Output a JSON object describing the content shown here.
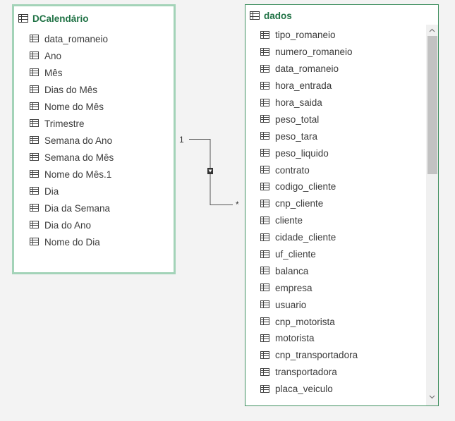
{
  "left_table": {
    "title": "DCalendário",
    "fields": [
      "data_romaneio",
      "Ano",
      "Mês",
      "Dias do Mês",
      "Nome do Mês",
      "Trimestre",
      "Semana do Ano",
      "Semana do Mês",
      "Nome do Mês.1",
      "Dia",
      "Dia da Semana",
      "Dia do Ano",
      "Nome do Dia"
    ]
  },
  "right_table": {
    "title": "dados",
    "fields": [
      "tipo_romaneio",
      "numero_romaneio",
      "data_romaneio",
      "hora_entrada",
      "hora_saida",
      "peso_total",
      "peso_tara",
      "peso_liquido",
      "contrato",
      "codigo_cliente",
      "cnp_cliente",
      "cliente",
      "cidade_cliente",
      "uf_cliente",
      "balanca",
      "empresa",
      "usuario",
      "cnp_motorista",
      "motorista",
      "cnp_transportadora",
      "transportadora",
      "placa_veiculo"
    ]
  },
  "relationship": {
    "one_label": "1",
    "many_label": "*"
  },
  "colors": {
    "accent": "#217346",
    "active_border": "#a3d3b8",
    "border": "#3f8f5f"
  },
  "icons": {
    "table": "table-icon",
    "field": "field-table-icon",
    "up": "chevron-up-icon",
    "down": "chevron-down-icon"
  }
}
